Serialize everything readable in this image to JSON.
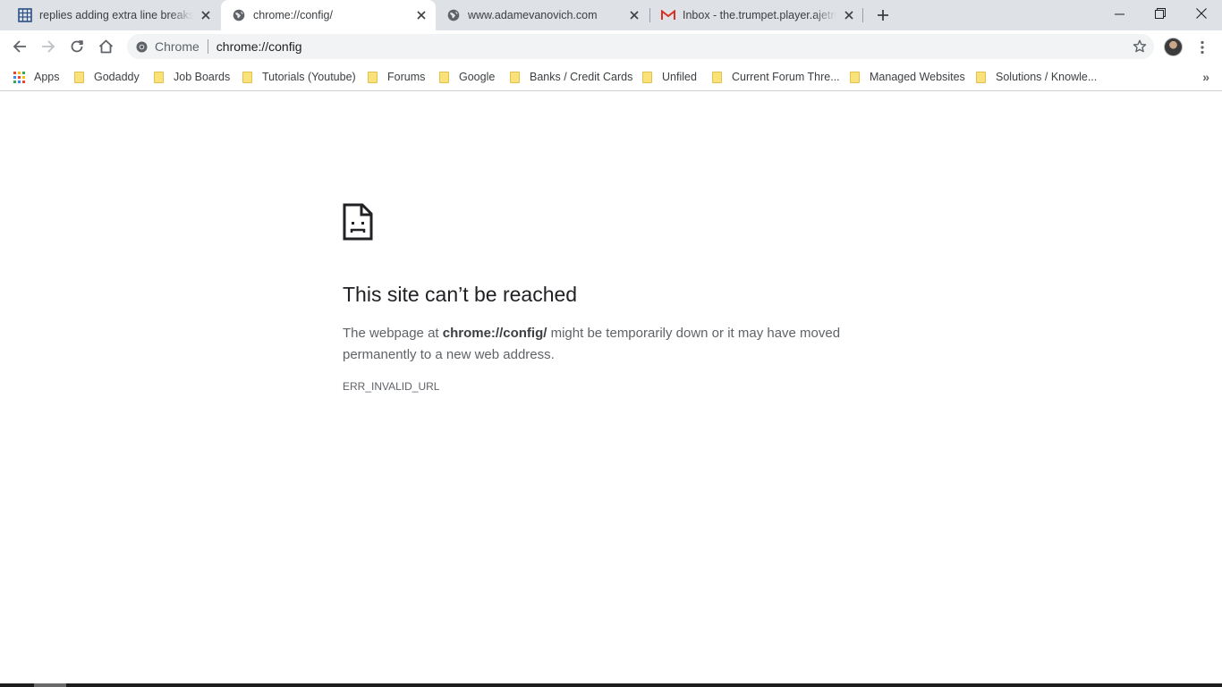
{
  "tabs": [
    {
      "title": "replies adding extra line breaks w",
      "favicon": "grid-doc-icon",
      "active": false
    },
    {
      "title": "chrome://config/",
      "favicon": "globe-icon",
      "active": true
    },
    {
      "title": "www.adamevanovich.com",
      "favicon": "globe-icon",
      "active": false
    },
    {
      "title": "Inbox - the.trumpet.player.ajetrum",
      "favicon": "gmail-icon",
      "active": false
    }
  ],
  "omnibox": {
    "chip_label": "Chrome",
    "url": "chrome://config"
  },
  "bookmarks": {
    "apps_label": "Apps",
    "items": [
      "Godaddy",
      "Job Boards",
      "Tutorials (Youtube)",
      "Forums",
      "Google",
      "Banks / Credit Cards",
      "Unfiled",
      "Current Forum Thre...",
      "Managed Websites",
      "Solutions / Knowle..."
    ],
    "more": "»"
  },
  "error": {
    "heading": "This site can’t be reached",
    "body_prefix": "The webpage at ",
    "body_url": "chrome://config/",
    "body_suffix": " might be temporarily down or it may have moved permanently to a new web address.",
    "code": "ERR_INVALID_URL"
  },
  "colors": {
    "tabstrip": "#dee1e6",
    "omnibox": "#f1f3f4",
    "heading": "#202124",
    "body": "#5f6368",
    "folder": "#f9e27a"
  }
}
